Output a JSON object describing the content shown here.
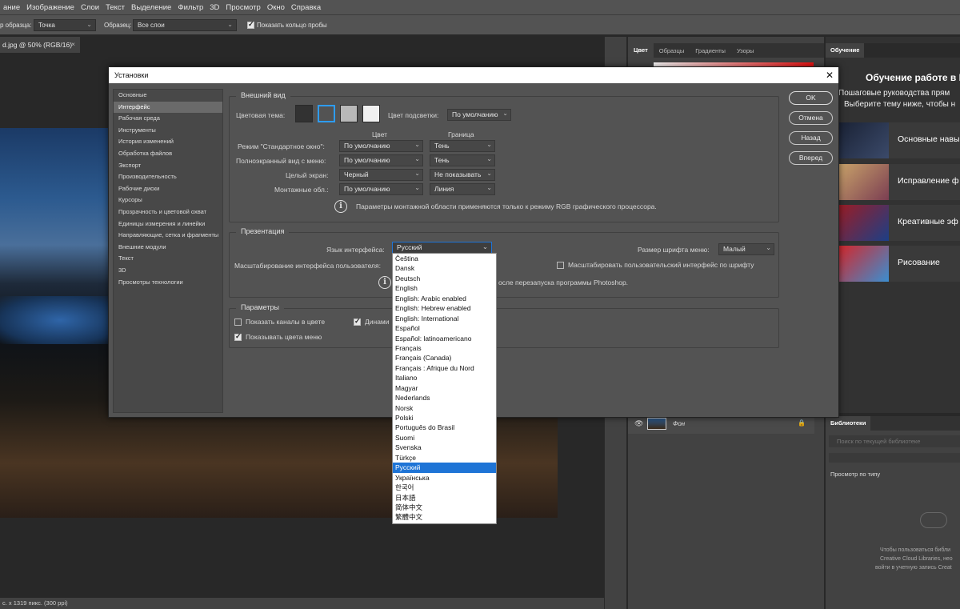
{
  "menubar": [
    "ание",
    "Изображение",
    "Слои",
    "Текст",
    "Выделение",
    "Фильтр",
    "3D",
    "Просмотр",
    "Окно",
    "Справка"
  ],
  "optionsbar": {
    "sample_label": "р образца:",
    "sample_value": "Точка",
    "samples_label": "Образец:",
    "samples_value": "Все слои",
    "show_ring_label": "Показать кольцо пробы"
  },
  "document": {
    "tab": "d.jpg @ 50% (RGB/16)",
    "status": "с. x 1319 пикс. (300 ppi)"
  },
  "right_panel": {
    "tabs": [
      "Цвет",
      "Образцы",
      "Градиенты",
      "Узоры"
    ],
    "layer_name": "Фон"
  },
  "learn": {
    "tab": "Обучение",
    "heading": "Обучение работе в Р",
    "sub1": "Пошаговые руководства прям",
    "sub2": "Выберите тему ниже, чтобы н",
    "cards": [
      "Основные навы",
      "Исправление ф",
      "Креативные эф",
      "Рисование"
    ]
  },
  "libraries": {
    "tab": "Библиотеки",
    "search_placeholder": "Поиск по текущей библиотеке",
    "view_by": "Просмотр по типу",
    "msg1": "Чтобы пользоваться библи",
    "msg2": "Creative Cloud Libraries, нео",
    "msg3": "войти в учетную запись Creat"
  },
  "dialog": {
    "title": "Установки",
    "sidebar": [
      "Основные",
      "Интерфейс",
      "Рабочая среда",
      "Инструменты",
      "История изменений",
      "Обработка файлов",
      "Экспорт",
      "Производительность",
      "Рабочие диски",
      "Курсоры",
      "Прозрачность и цветовой охват",
      "Единицы измерения и линейки",
      "Направляющие, сетка и фрагменты",
      "Внешние модули",
      "Текст",
      "3D",
      "Просмотры технологии"
    ],
    "buttons": {
      "ok": "OK",
      "cancel": "Отмена",
      "back": "Назад",
      "forward": "Вперед"
    },
    "appearance": {
      "title": "Внешний вид",
      "theme_label": "Цветовая тема:",
      "highlight_label": "Цвет подсветки:",
      "highlight_value": "По умолчанию",
      "col_color": "Цвет",
      "col_border": "Граница",
      "rows": [
        {
          "label": "Режим \"Стандартное окно\":",
          "color": "По умолчанию",
          "border": "Тень"
        },
        {
          "label": "Полноэкранный вид с меню:",
          "color": "По умолчанию",
          "border": "Тень"
        },
        {
          "label": "Целый экран:",
          "color": "Черный",
          "border": "Не показывать"
        },
        {
          "label": "Монтажные обл.:",
          "color": "По умолчанию",
          "border": "Линия"
        }
      ],
      "note": "Параметры монтажной области применяются только к режиму RGB графического процессора."
    },
    "presentation": {
      "title": "Презентация",
      "lang_label": "Язык интерфейса:",
      "lang_value": "Русский",
      "fontsize_label": "Размер шрифта меню:",
      "fontsize_value": "Малый",
      "scale_label": "Масштабирование интерфейса пользователя:",
      "scale_font_label": "Масштабировать пользовательский интерфейс по шрифту",
      "note": "осле перезапуска программы Photoshop."
    },
    "params": {
      "title": "Параметры",
      "show_channels": "Показать каналы в цвете",
      "dynamic": "Динами",
      "show_menu_colors": "Показывать цвета меню"
    }
  },
  "languages": [
    "Čeština",
    "Dansk",
    "Deutsch",
    "English",
    "English: Arabic enabled",
    "English: Hebrew enabled",
    "English: International",
    "Español",
    "Español: latinoamericano",
    "Français",
    "Français (Canada)",
    "Français : Afrique du Nord",
    "Italiano",
    "Magyar",
    "Nederlands",
    "Norsk",
    "Polski",
    "Português do Brasil",
    "Suomi",
    "Svenska",
    "Türkçe",
    "Русский",
    "Українська",
    "한국어",
    "日本語",
    "简体中文",
    "繁體中文"
  ],
  "selected_language_index": 21,
  "colors": {
    "accent": "#1e74d6",
    "dialog_bg": "#535353"
  }
}
